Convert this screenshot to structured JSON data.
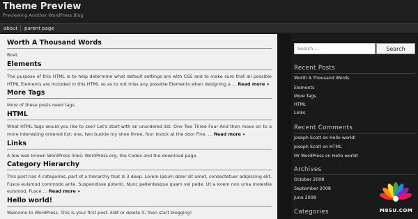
{
  "header": {
    "title": "Theme Preview",
    "description": "Previewing Another WordPress Blog"
  },
  "nav": {
    "items": [
      "about",
      "parent page"
    ]
  },
  "posts": [
    {
      "title": "Worth A Thousand Words",
      "text": "Boat."
    },
    {
      "title": "Elements",
      "text": "The purpose of this HTML is to help determine what default settings are with CSS and to make sure that all possible HTML Elements are included in this HTML so as to not miss any possible Elements when designing a …",
      "more": "Read more »"
    },
    {
      "title": "More Tags",
      "text": "More of these posts need tags."
    },
    {
      "title": "HTML",
      "text": "What HTML tags would you like to see? Let's start with an unordered list: One Two Three Four And then move on to a more interesting ordered list: one, two buckle my shoe three, four knock at the door Five, …",
      "more": "Read more »"
    },
    {
      "title": "Links",
      "text": "A few well known WordPress links: WordPress.org, the Codex and the download page."
    },
    {
      "title": "Category Hierarchy",
      "text": "This post has 4 categories, part of a hierarchy that is 3 deep. Lorem ipsum dolor sit amet, consectetuer adipiscing elit. Fusce euismod commodo ante. Suspendisse potenti. Nunc pellentesque quam vel pede. Ut a lorem non urna molestie euismod. Fusce …",
      "more": "Read more »"
    },
    {
      "title": "Hello world!",
      "text": "Welcome to WordPress. This is your first post. Edit or delete it, then start blogging!"
    }
  ],
  "sidebar": {
    "search": {
      "placeholder": "Search …",
      "button": "Search"
    },
    "recent_posts": {
      "title": "Recent Posts",
      "items": [
        "Worth A Thousand Words",
        "Elements",
        "More Tags",
        "HTML",
        "Links"
      ]
    },
    "recent_comments": {
      "title": "Recent Comments",
      "items": [
        "Joseph Scott on Hello world!",
        "Joseph Scott on HTML",
        "Mr WordPress on Hello world!"
      ]
    },
    "archives": {
      "title": "Archives",
      "items": [
        "October 2008",
        "September 2008",
        "June 2008"
      ]
    },
    "categories": {
      "title": "Categories"
    }
  },
  "watermark": {
    "text": "M8SU.COM"
  }
}
